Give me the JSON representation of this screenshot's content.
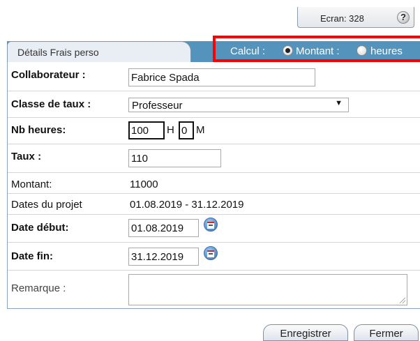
{
  "header": {
    "ecran_label": "Ecran: 328",
    "help_glyph": "?"
  },
  "tab": {
    "label": "Détails Frais perso"
  },
  "calcul": {
    "label": "Calcul :",
    "option_montant": "Montant :",
    "option_heures": "heures",
    "selected": "Montant"
  },
  "form": {
    "collaborateur": {
      "label": "Collaborateur :",
      "value": "Fabrice Spada"
    },
    "classe_taux": {
      "label": "Classe de taux :",
      "value": "Professeur",
      "arrow": "▼"
    },
    "nb_heures": {
      "label": "Nb heures:",
      "hours": "100",
      "h_unit": "H",
      "minutes": "0",
      "m_unit": "M"
    },
    "taux": {
      "label": "Taux :",
      "value": "110"
    },
    "montant": {
      "label": "Montant:",
      "value": "11000"
    },
    "dates_projet": {
      "label": "Dates du projet",
      "value": "01.08.2019 - 31.12.2019"
    },
    "date_debut": {
      "label": "Date début:",
      "value": "01.08.2019"
    },
    "date_fin": {
      "label": "Date fin:",
      "value": "31.12.2019"
    },
    "remarque": {
      "label": "Remarque :",
      "value": ""
    }
  },
  "buttons": {
    "save": "Enregistrer",
    "close": "Fermer"
  },
  "colors": {
    "tab_bar": "#5493bc",
    "highlight_border": "#ff0000"
  },
  "icons": {
    "help": "help-icon",
    "calendar": "calendar-icon"
  }
}
